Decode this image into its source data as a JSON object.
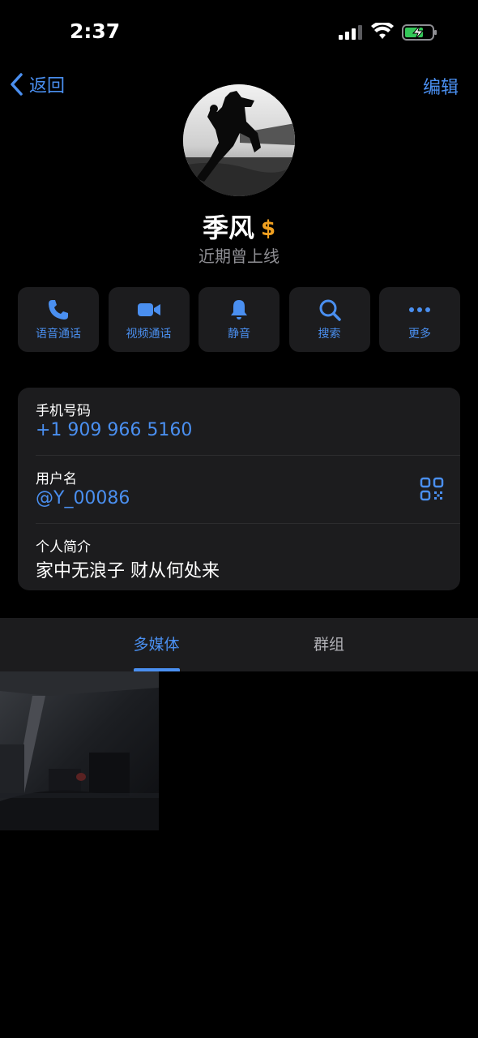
{
  "status_bar": {
    "time": "2:37",
    "signal_icon": "cellular-signal-icon",
    "wifi_icon": "wifi-icon",
    "battery_icon": "battery-charging-icon"
  },
  "nav": {
    "back_label": "返回",
    "edit_label": "编辑"
  },
  "profile": {
    "name": "季风",
    "badge": "$",
    "status": "近期曾上线"
  },
  "actions": [
    {
      "label": "语音通话",
      "icon": "phone-icon"
    },
    {
      "label": "视频通话",
      "icon": "video-camera-icon"
    },
    {
      "label": "静音",
      "icon": "bell-icon"
    },
    {
      "label": "搜索",
      "icon": "search-icon"
    },
    {
      "label": "更多",
      "icon": "more-dots-icon"
    }
  ],
  "info": {
    "phone_caption": "手机号码",
    "phone_value": "+1 909 966 5160",
    "username_caption": "用户名",
    "username_value": "@Y_00086",
    "bio_caption": "个人简介",
    "bio_value": "家中无浪子 财从何处来"
  },
  "tabs": [
    {
      "label": "多媒体",
      "active": true
    },
    {
      "label": "群组",
      "active": false
    }
  ],
  "colors": {
    "accent": "#4a8ff0",
    "background": "#000000",
    "card": "#1c1c1e",
    "secondary_text": "#8e8e93"
  }
}
